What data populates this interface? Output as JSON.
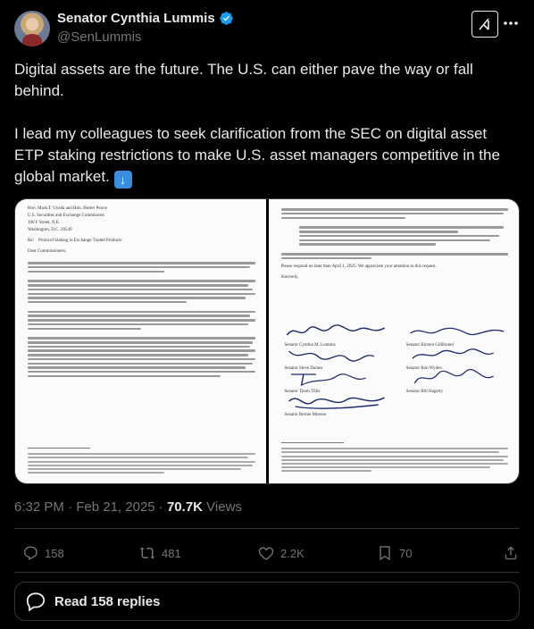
{
  "author": {
    "display_name": "Senator Cynthia Lummis",
    "handle": "@SenLummis",
    "verified": true
  },
  "icons": {
    "verified": "verified-badge-icon",
    "grok": "grok-icon",
    "more": "more-options-icon",
    "reply": "reply-icon",
    "repost": "repost-icon",
    "like": "heart-icon",
    "views": "views-icon",
    "share": "share-icon",
    "replies": "reply-bubble-icon"
  },
  "post": {
    "paragraph1": "Digital assets are the future. The U.S. can either pave the way or fall behind.",
    "paragraph2": "I lead my colleagues to seek clarification from the SEC on digital asset ETP staking restrictions to make U.S. asset managers competitive in the global market.",
    "emoji": "⬇️"
  },
  "document": {
    "left": {
      "address": [
        "Hon. Mark T. Uyeda and Hon. Hester Peirce",
        "U.S. Securities and Exchange Commission",
        "100 F Street, N.E.",
        "Washington, D.C. 20549"
      ],
      "re_label": "Re:",
      "re_text": "Protocol Staking in Exchange Traded Products",
      "salutation": "Dear Commissioners,"
    },
    "right": {
      "closing_request": "Please respond no later than April 1, 2025. We appreciate your attention to this request.",
      "sincerely": "Sincerely,",
      "signatories": [
        "Senator Cynthia M. Lummis",
        "Senator Kirsten Gillibrand",
        "Senator Steve Daines",
        "Senator Ron Wyden",
        "Senator Thom Tillis",
        "Senator Bill Hagerty",
        "Senator Bernie Moreno"
      ]
    }
  },
  "meta": {
    "time": "6:32 PM",
    "separator": "·",
    "date": "Feb 21, 2025",
    "views_count": "70.7K",
    "views_label": "Views"
  },
  "actions": {
    "replies": "158",
    "reposts": "481",
    "likes": "2.2K",
    "bookmarks": "70"
  },
  "read_replies_label": "Read 158 replies",
  "colors": {
    "background": "#000000",
    "text": "#e7e9ea",
    "secondary": "#71767b",
    "verified": "#1d9bf0",
    "border": "#2f3336"
  }
}
